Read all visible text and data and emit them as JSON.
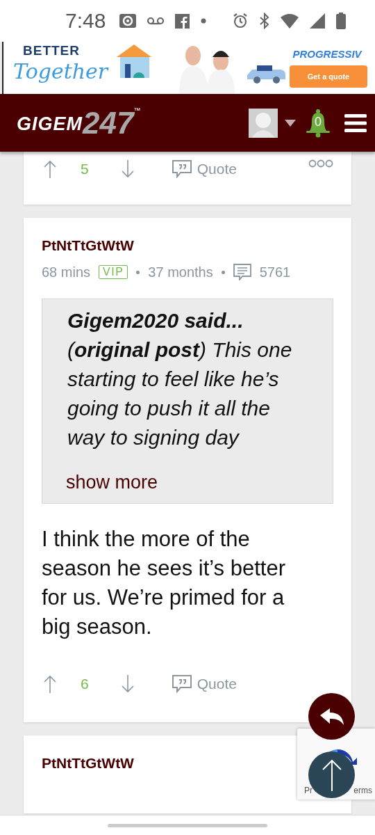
{
  "status_bar": {
    "time": "7:48"
  },
  "ad": {
    "headline_top": "BETTER",
    "headline_script": "Together",
    "brand": "PROGRESSIV",
    "cta": "Get a quote"
  },
  "header": {
    "logo_word": "GIGEM",
    "logo_number": "247",
    "logo_mark": "™",
    "notifications": "0"
  },
  "posts": [
    {
      "actions": {
        "score": "5",
        "quote": "Quote",
        "more": true
      }
    },
    {
      "author": "PtNtTtGtWtW",
      "time": "68 mins",
      "badge": "VIP",
      "tenure": "37 months",
      "post_count": "5761",
      "quote": {
        "text": "**Gigem2020 said...** (**original post**) This one starting to feel like he’s going to push it all the way to signing day",
        "link": "show more"
      },
      "body": "I think the more of the season he sees it’s better for us. We’re primed for a big season.",
      "actions": {
        "score": "6",
        "quote": "Quote",
        "more": false
      }
    },
    {
      "author": "PtNtTtGtWtW"
    }
  ],
  "recaptcha": {
    "left": "Pr",
    "right": "erms"
  }
}
